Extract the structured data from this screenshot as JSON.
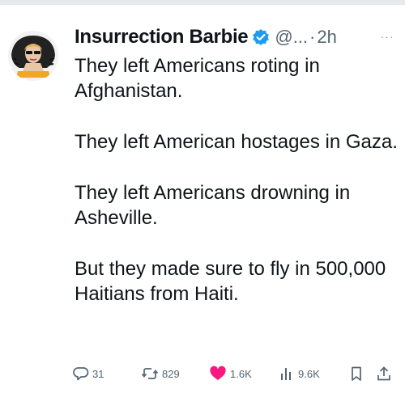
{
  "tweet": {
    "author": {
      "display_name": "Insurrection Barbie",
      "handle": "@...",
      "separator": "·",
      "time": "2h",
      "avatar_icon": "woman-portrait-avatar",
      "verified_color": "#1d9bf0"
    },
    "more_label": "···",
    "paragraphs": [
      "They left Americans roting in Afghanistan.",
      "They left American hostages in Gaza.",
      "They left Americans drowning in Asheville.",
      "But they made sure to fly in 500,000 Haitians from Haiti."
    ],
    "actions": {
      "replies": "31",
      "reposts": "829",
      "likes": "1.6K",
      "views": "9.6K"
    },
    "colors": {
      "text": "#0f1419",
      "muted": "#536471",
      "like": "#f91880",
      "verified": "#1d9bf0"
    }
  }
}
